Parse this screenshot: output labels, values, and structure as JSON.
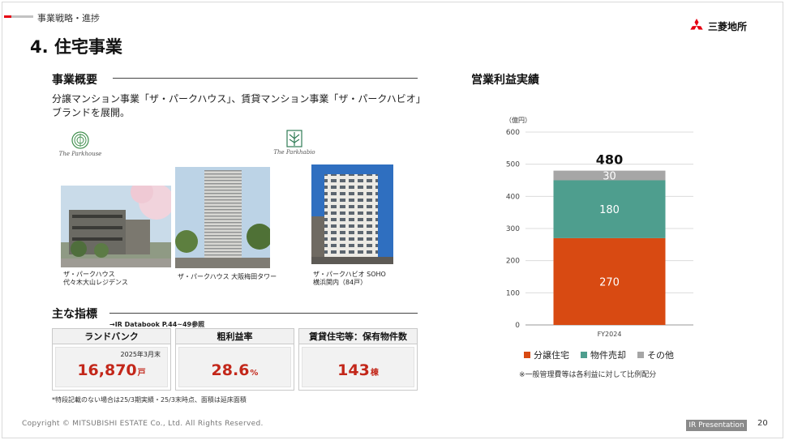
{
  "breadcrumb": "事業戦略・進捗",
  "logo": {
    "text": "三菱地所"
  },
  "page_title": "4. 住宅事業",
  "overview": {
    "heading": "事業概要",
    "text": "分譲マンション事業「ザ・パークハウス」、賃貸マンション事業「ザ・パークハビオ」ブランドを展開。",
    "brands": [
      "The Parkhouse",
      "The Parkhabio"
    ],
    "photos": [
      {
        "caption_line1": "ザ・パークハウス",
        "caption_line2": "代々木大山レジデンス"
      },
      {
        "caption_line1": "ザ・パークハウス 大阪梅田タワー",
        "caption_line2": ""
      },
      {
        "caption_line1": "ザ・パークハビオ SOHO",
        "caption_line2": "横浜関内（84戸）"
      }
    ]
  },
  "kpi": {
    "heading": "主な指標",
    "note": "→IR Databook P.44~49参照",
    "cards": [
      {
        "title": "ランドバンク",
        "date": "2025年3月末",
        "value": "16,870",
        "unit": "戸"
      },
      {
        "title": "粗利益率",
        "date": "",
        "value": "28.6",
        "unit": "%"
      },
      {
        "title": "賃貸住宅等：保有物件数",
        "date": "",
        "value": "143",
        "unit": "棟"
      }
    ]
  },
  "footnote": "*特段記載のない場合は25/3期実績・25/3末時点、面積は延床面積",
  "copyright": "Copyright © MITSUBISHI ESTATE Co., Ltd. All Rights Reserved.",
  "ir_badge": "IR Presentation",
  "page_number": "20",
  "chart_note": "※一般管理費等は各利益に対して比例配分",
  "colors": {
    "residential": "#d84a12",
    "property_sales": "#4e9e8e",
    "other": "#a6a6a6",
    "kpi_value": "#c3271a",
    "accent_red": "#e60012"
  },
  "chart_data": {
    "type": "bar",
    "stacked": true,
    "title": "営業利益実績",
    "ylabel": "（億円）",
    "xlabel": "",
    "categories": [
      "FY2024"
    ],
    "ylim": [
      0,
      600
    ],
    "yticks": [
      0,
      100,
      200,
      300,
      400,
      500,
      600
    ],
    "grid": true,
    "total_labels": [
      "480"
    ],
    "series": [
      {
        "name": "分譲住宅",
        "values": [
          270
        ],
        "color": "#d84a12"
      },
      {
        "name": "物件売却",
        "values": [
          180
        ],
        "color": "#4e9e8e"
      },
      {
        "name": "その他",
        "values": [
          30
        ],
        "color": "#a6a6a6"
      }
    ],
    "legend_position": "bottom"
  }
}
